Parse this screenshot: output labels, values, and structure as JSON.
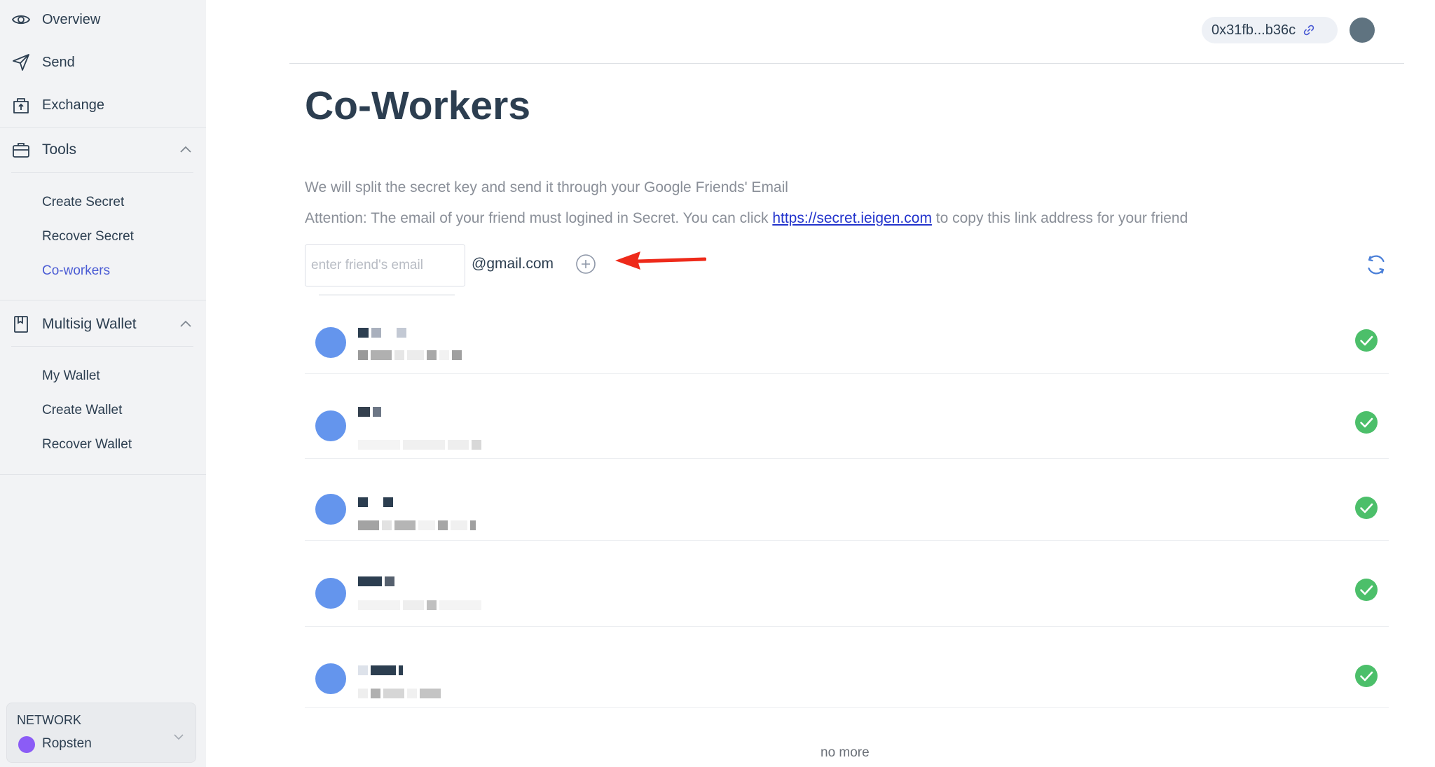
{
  "sidebar": {
    "nav": [
      {
        "label": "Overview",
        "icon": "eye-icon"
      },
      {
        "label": "Send",
        "icon": "send-icon"
      },
      {
        "label": "Exchange",
        "icon": "exchange-icon"
      }
    ],
    "tools": {
      "label": "Tools",
      "icon": "toolbox-icon",
      "items": [
        "Create Secret",
        "Recover Secret",
        "Co-workers"
      ],
      "active": "Co-workers"
    },
    "multisig": {
      "label": "Multisig Wallet",
      "icon": "wallet-book-icon",
      "items": [
        "My Wallet",
        "Create Wallet",
        "Recover Wallet"
      ]
    },
    "network": {
      "label": "NETWORK",
      "name": "Ropsten",
      "dot_color": "#8b5cf6"
    }
  },
  "header": {
    "address": "0x31fb...b36c",
    "address_icon": "link-icon",
    "avatar_color": "#5f7380"
  },
  "main": {
    "title": "Co-Workers",
    "info_line1": "We will split the secret key and send it through your Google Friends' Email",
    "info_line2_prefix": "Attention: The email of your friend must logined in Secret. You can click ",
    "info_link": "https://secret.ieigen.com",
    "info_line2_suffix": " to copy this link address for your friend",
    "email_placeholder": "enter friend's email",
    "email_value": "",
    "email_domain": "@gmail.com",
    "coworkers_count": 5,
    "footer": "no more"
  },
  "colors": {
    "accent": "#4a5bd4",
    "avatar": "#6495ed",
    "check": "#4cbf6a",
    "arrow": "#ee2a1a"
  }
}
